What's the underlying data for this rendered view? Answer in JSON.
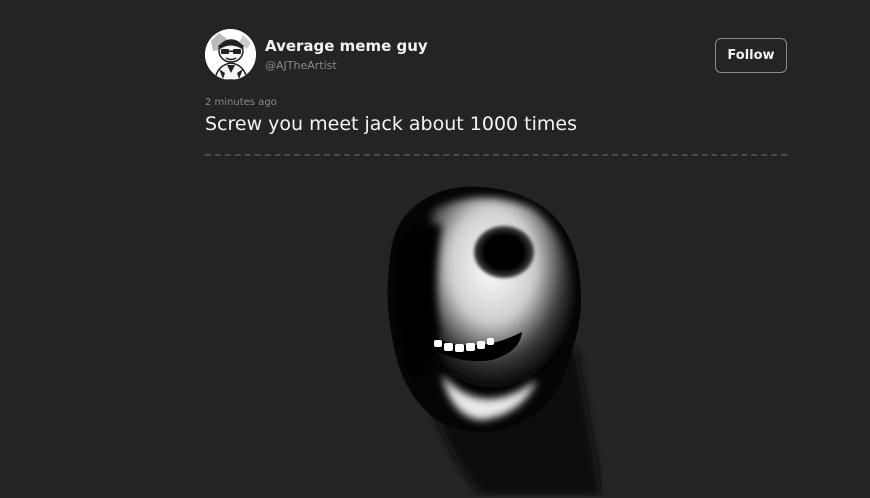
{
  "post": {
    "author": {
      "name": "Average meme guy",
      "handle": "@AJTheArtist",
      "avatar_icon": "cartoon-avatar-icon"
    },
    "follow_label": "Follow",
    "timestamp": "2 minutes ago",
    "text": "Screw you meet jack about 1000 times",
    "media": {
      "icon": "creepy-smiling-face-image"
    }
  },
  "colors": {
    "background": "#242424",
    "text_primary": "#f4f4f4",
    "text_secondary": "#8a8a8a",
    "button_border": "#8a8a8a"
  }
}
